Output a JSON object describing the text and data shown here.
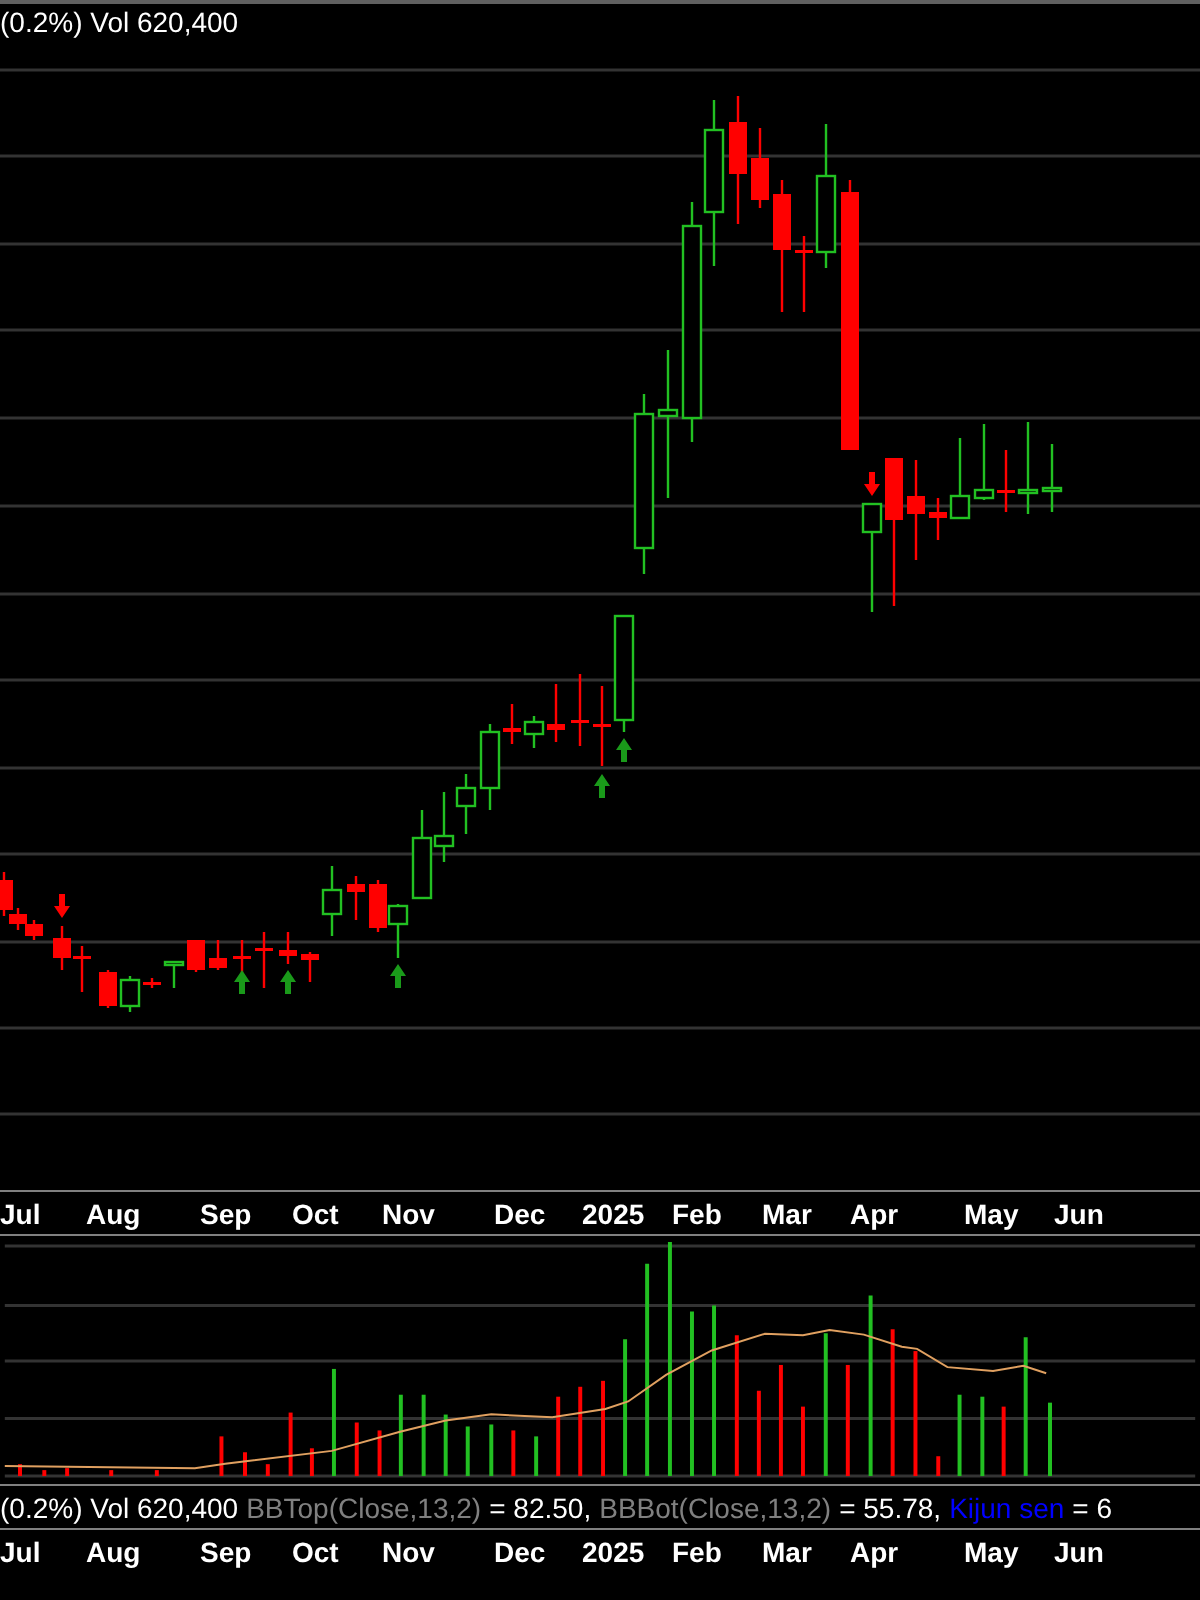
{
  "header": {
    "text": "(0.2%) Vol 620,400"
  },
  "price_axis": {
    "months": [
      "Jul",
      "Aug",
      "Sep",
      "Oct",
      "Nov",
      "Dec",
      "2025",
      "Feb",
      "Mar",
      "Apr",
      "May",
      "Jun"
    ]
  },
  "legend": [
    {
      "text": "(0.2%) Vol 620,400",
      "color": "#ffffff"
    },
    {
      "text": "BBTop(Close,13,2)",
      "color": "#808080"
    },
    {
      "text": "= 82.50,",
      "color": "#ffffff"
    },
    {
      "text": "BBBot(Close,13,2)",
      "color": "#808080"
    },
    {
      "text": "= 55.78,",
      "color": "#ffffff"
    },
    {
      "text": "Kijun sen",
      "color": "#0000ff"
    },
    {
      "text": "= 6",
      "color": "#ffffff"
    }
  ],
  "volume_axis": {
    "months": [
      "Jul",
      "Aug",
      "Sep",
      "Oct",
      "Nov",
      "Dec",
      "2025",
      "Feb",
      "Mar",
      "Apr",
      "May",
      "Jun"
    ]
  }
}
